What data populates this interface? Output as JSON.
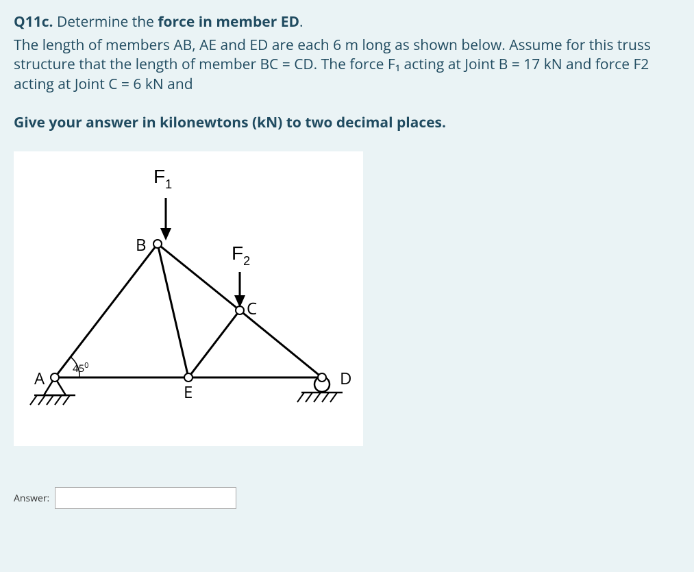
{
  "question": {
    "number": "Q11c.",
    "prompt_prefix": "Determine the ",
    "prompt_bold": "force in member ED",
    "prompt_suffix": ".",
    "body_html": "The length of members AB, AE and ED are each 6 m long as shown below. Assume for this truss structure that the length of member BC = CD. The force F₁ acting at Joint B = 17 kN and force F2 acting at Joint C = 6 kN and",
    "instruction": "Give your answer in kilonewtons (kN) to two decimal places."
  },
  "figure": {
    "forces": {
      "F1": "F",
      "F1sub": "1",
      "F2": "F",
      "F2sub": "2"
    },
    "nodes": {
      "A": "A",
      "B": "B",
      "C": "C",
      "D": "D",
      "E": "E"
    },
    "angle": "45",
    "angle_deg": "0"
  },
  "answer": {
    "label": "Answer:",
    "value": ""
  }
}
